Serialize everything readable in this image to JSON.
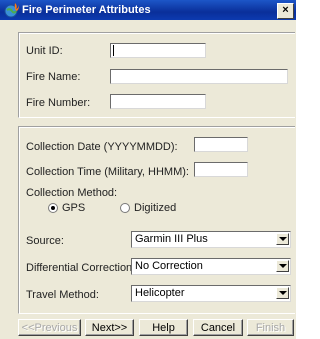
{
  "window": {
    "title": "Fire Perimeter Attributes",
    "close_glyph": "×"
  },
  "fields": {
    "unit_id": {
      "label": "Unit ID:",
      "value": ""
    },
    "fire_name": {
      "label": "Fire Name:",
      "value": ""
    },
    "fire_number": {
      "label": "Fire Number:",
      "value": ""
    },
    "collection_date": {
      "label": "Collection Date (YYYYMMDD):",
      "value": ""
    },
    "collection_time": {
      "label": "Collection Time (Military, HHMM):",
      "value": ""
    }
  },
  "collection_method": {
    "label": "Collection Method:",
    "options": [
      {
        "label": "GPS",
        "selected": true
      },
      {
        "label": "Digitized",
        "selected": false
      }
    ]
  },
  "dropdowns": {
    "source": {
      "label": "Source:",
      "value": "Garmin III Plus"
    },
    "differential_correction": {
      "label": "Differential Correction:",
      "value": "No Correction"
    },
    "travel_method": {
      "label": "Travel Method:",
      "value": "Helicopter"
    }
  },
  "buttons": {
    "previous": {
      "label": "<<Previous",
      "enabled": false
    },
    "next": {
      "label": "Next>>",
      "enabled": true
    },
    "help": {
      "label": "Help",
      "enabled": true
    },
    "cancel": {
      "label": "Cancel",
      "enabled": true
    },
    "finish": {
      "label": "Finish",
      "enabled": false
    }
  },
  "colors": {
    "title_bar": "#0a2f9a",
    "dialog_face": "#ece9d8",
    "disabled_text": "#a8a8a8"
  },
  "icons": {
    "title": "fire-globe-icon",
    "dropdown": "chevron-down-icon"
  }
}
